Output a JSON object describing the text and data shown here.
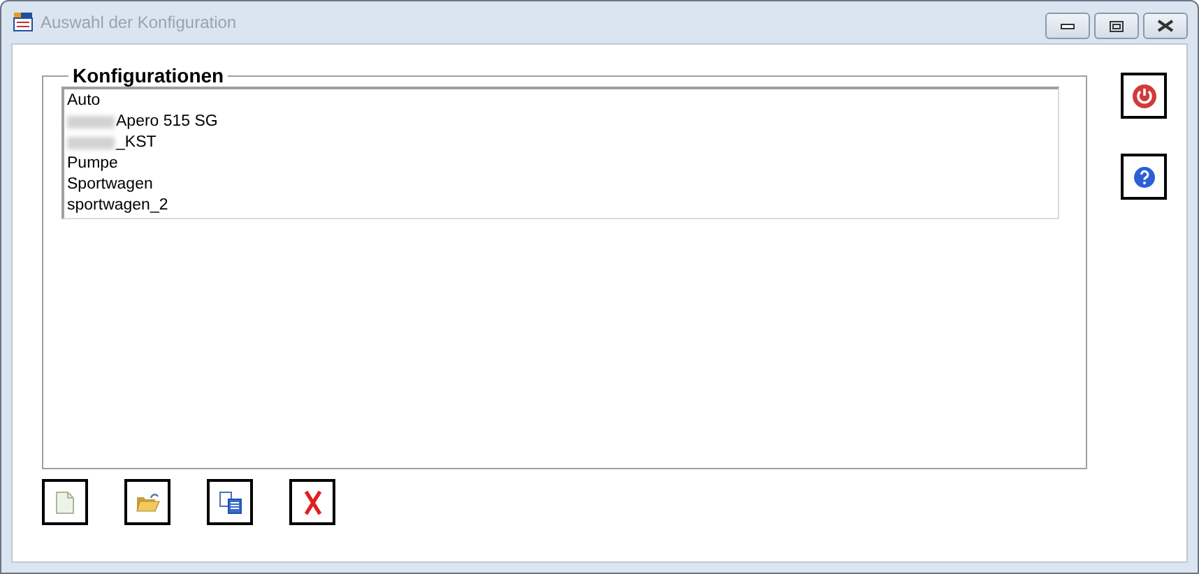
{
  "window": {
    "title": "Auswahl der Konfiguration",
    "disabled": true
  },
  "group": {
    "title": "Konfigurationen"
  },
  "configurations": [
    {
      "label": "Auto",
      "redacted": false
    },
    {
      "label": "Apero 515 SG",
      "redacted": true
    },
    {
      "label": "_KST",
      "redacted": true
    },
    {
      "label": "Pumpe",
      "redacted": false
    },
    {
      "label": "Sportwagen",
      "redacted": false
    },
    {
      "label": "sportwagen_2",
      "redacted": false
    }
  ],
  "side_buttons": [
    {
      "kind": "power"
    },
    {
      "kind": "help"
    }
  ],
  "bottom_buttons": [
    {
      "kind": "new"
    },
    {
      "kind": "open"
    },
    {
      "kind": "copy"
    },
    {
      "kind": "delete"
    }
  ]
}
